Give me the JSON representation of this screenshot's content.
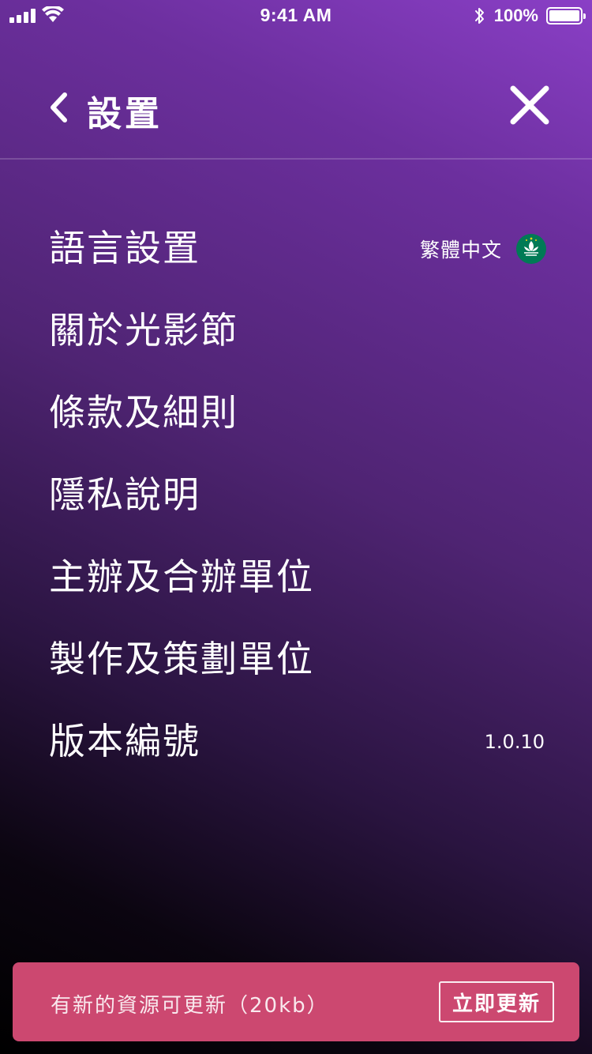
{
  "status_bar": {
    "time": "9:41 AM",
    "battery_percent": "100%",
    "battery_level": 1.0,
    "icons": [
      "signal-icon",
      "wifi-icon",
      "bluetooth-icon",
      "battery-icon"
    ]
  },
  "header": {
    "title": "設置",
    "back_icon": "chevron-left-icon",
    "close_icon": "close-icon"
  },
  "menu": {
    "items": [
      {
        "label": "語言設置",
        "value": "繁體中文",
        "value_icon": "macau-flag-icon"
      },
      {
        "label": "關於光影節"
      },
      {
        "label": "條款及細則"
      },
      {
        "label": "隱私說明"
      },
      {
        "label": "主辦及合辦單位"
      },
      {
        "label": "製作及策劃單位"
      },
      {
        "label": "版本編號",
        "value": "1.0.10"
      }
    ]
  },
  "update_banner": {
    "message": "有新的資源可更新（20kb）",
    "button_label": "立即更新",
    "color": "#cc4870"
  }
}
